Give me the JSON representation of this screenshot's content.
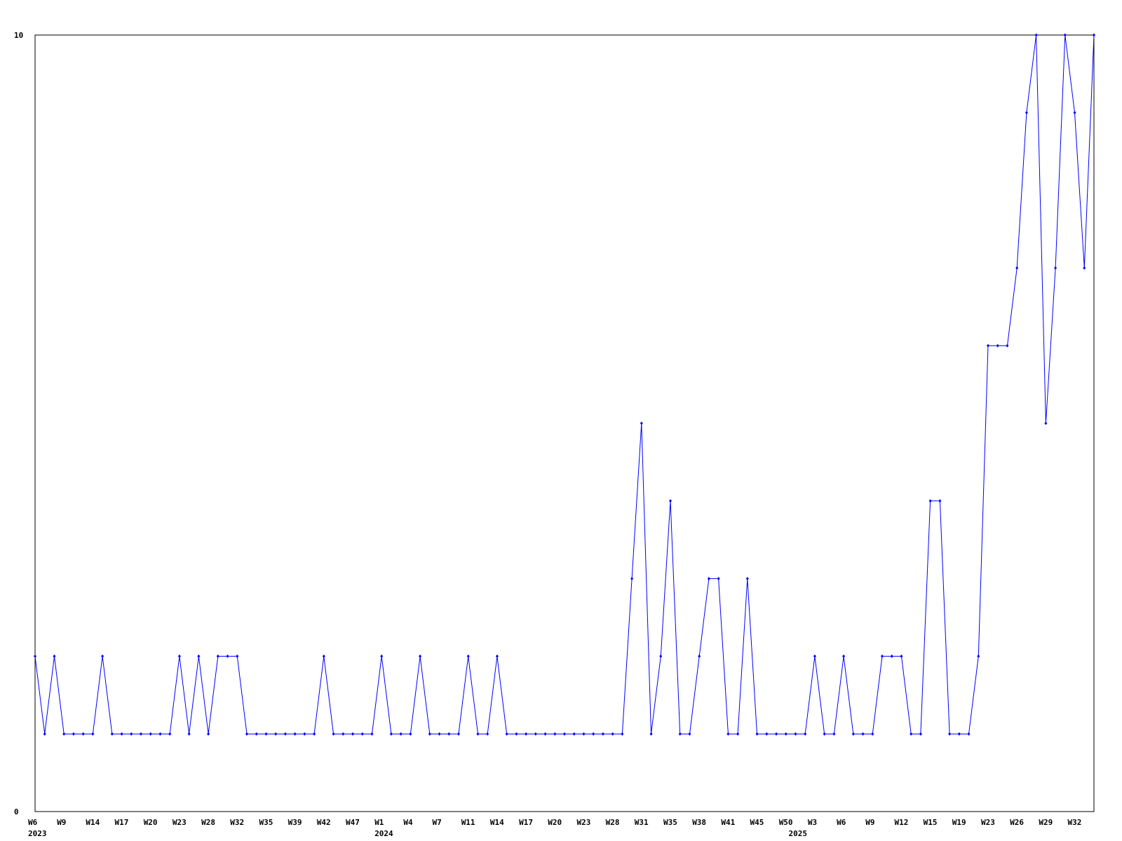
{
  "chart_data": {
    "type": "line",
    "title": "",
    "xlabel": "",
    "ylabel": "",
    "ylim": [
      0,
      10
    ],
    "y_tick_labels": [
      "0",
      "10"
    ],
    "grid": false,
    "legend": "none",
    "line_color": "#0000ff",
    "x_tick_labels": [
      {
        "index": 0,
        "label": "W6"
      },
      {
        "index": 3,
        "label": "W9"
      },
      {
        "index": 6,
        "label": "W14"
      },
      {
        "index": 9,
        "label": "W17"
      },
      {
        "index": 12,
        "label": "W20"
      },
      {
        "index": 15,
        "label": "W23"
      },
      {
        "index": 18,
        "label": "W28"
      },
      {
        "index": 21,
        "label": "W32"
      },
      {
        "index": 24,
        "label": "W35"
      },
      {
        "index": 27,
        "label": "W39"
      },
      {
        "index": 30,
        "label": "W42"
      },
      {
        "index": 33,
        "label": "W47"
      },
      {
        "index": 36,
        "label": "W1"
      },
      {
        "index": 39,
        "label": "W4"
      },
      {
        "index": 42,
        "label": "W7"
      },
      {
        "index": 45,
        "label": "W11"
      },
      {
        "index": 48,
        "label": "W14"
      },
      {
        "index": 51,
        "label": "W17"
      },
      {
        "index": 54,
        "label": "W20"
      },
      {
        "index": 57,
        "label": "W23"
      },
      {
        "index": 60,
        "label": "W28"
      },
      {
        "index": 63,
        "label": "W31"
      },
      {
        "index": 66,
        "label": "W35"
      },
      {
        "index": 69,
        "label": "W38"
      },
      {
        "index": 72,
        "label": "W41"
      },
      {
        "index": 75,
        "label": "W45"
      },
      {
        "index": 78,
        "label": "W50"
      },
      {
        "index": 81,
        "label": "W3"
      },
      {
        "index": 84,
        "label": "W6"
      },
      {
        "index": 87,
        "label": "W9"
      },
      {
        "index": 90,
        "label": "W12"
      },
      {
        "index": 93,
        "label": "W15"
      },
      {
        "index": 96,
        "label": "W19"
      },
      {
        "index": 99,
        "label": "W23"
      },
      {
        "index": 102,
        "label": "W26"
      },
      {
        "index": 105,
        "label": "W29"
      },
      {
        "index": 108,
        "label": "W32"
      }
    ],
    "year_labels": [
      {
        "index": 0,
        "label": "2023"
      },
      {
        "index": 36,
        "label": "2024"
      },
      {
        "index": 79,
        "label": "2025"
      }
    ],
    "series": [
      {
        "values": [
          2,
          1,
          2,
          1,
          1,
          1,
          1,
          2,
          1,
          1,
          1,
          1,
          1,
          1,
          1,
          2,
          1,
          2,
          1,
          2,
          2,
          2,
          1,
          1,
          1,
          1,
          1,
          1,
          1,
          1,
          2,
          1,
          1,
          1,
          1,
          1,
          2,
          1,
          1,
          1,
          2,
          1,
          1,
          1,
          1,
          2,
          1,
          1,
          2,
          1,
          1,
          1,
          1,
          1,
          1,
          1,
          1,
          1,
          1,
          1,
          1,
          1,
          3,
          5,
          1,
          2,
          4,
          1,
          1,
          2,
          3,
          3,
          1,
          1,
          3,
          1,
          1,
          1,
          1,
          1,
          1,
          2,
          1,
          1,
          2,
          1,
          1,
          1,
          2,
          2,
          2,
          1,
          1,
          4,
          4,
          1,
          1,
          1,
          2,
          6,
          6,
          6,
          7,
          9,
          10,
          5,
          7,
          10,
          9,
          7,
          10
        ]
      }
    ]
  }
}
